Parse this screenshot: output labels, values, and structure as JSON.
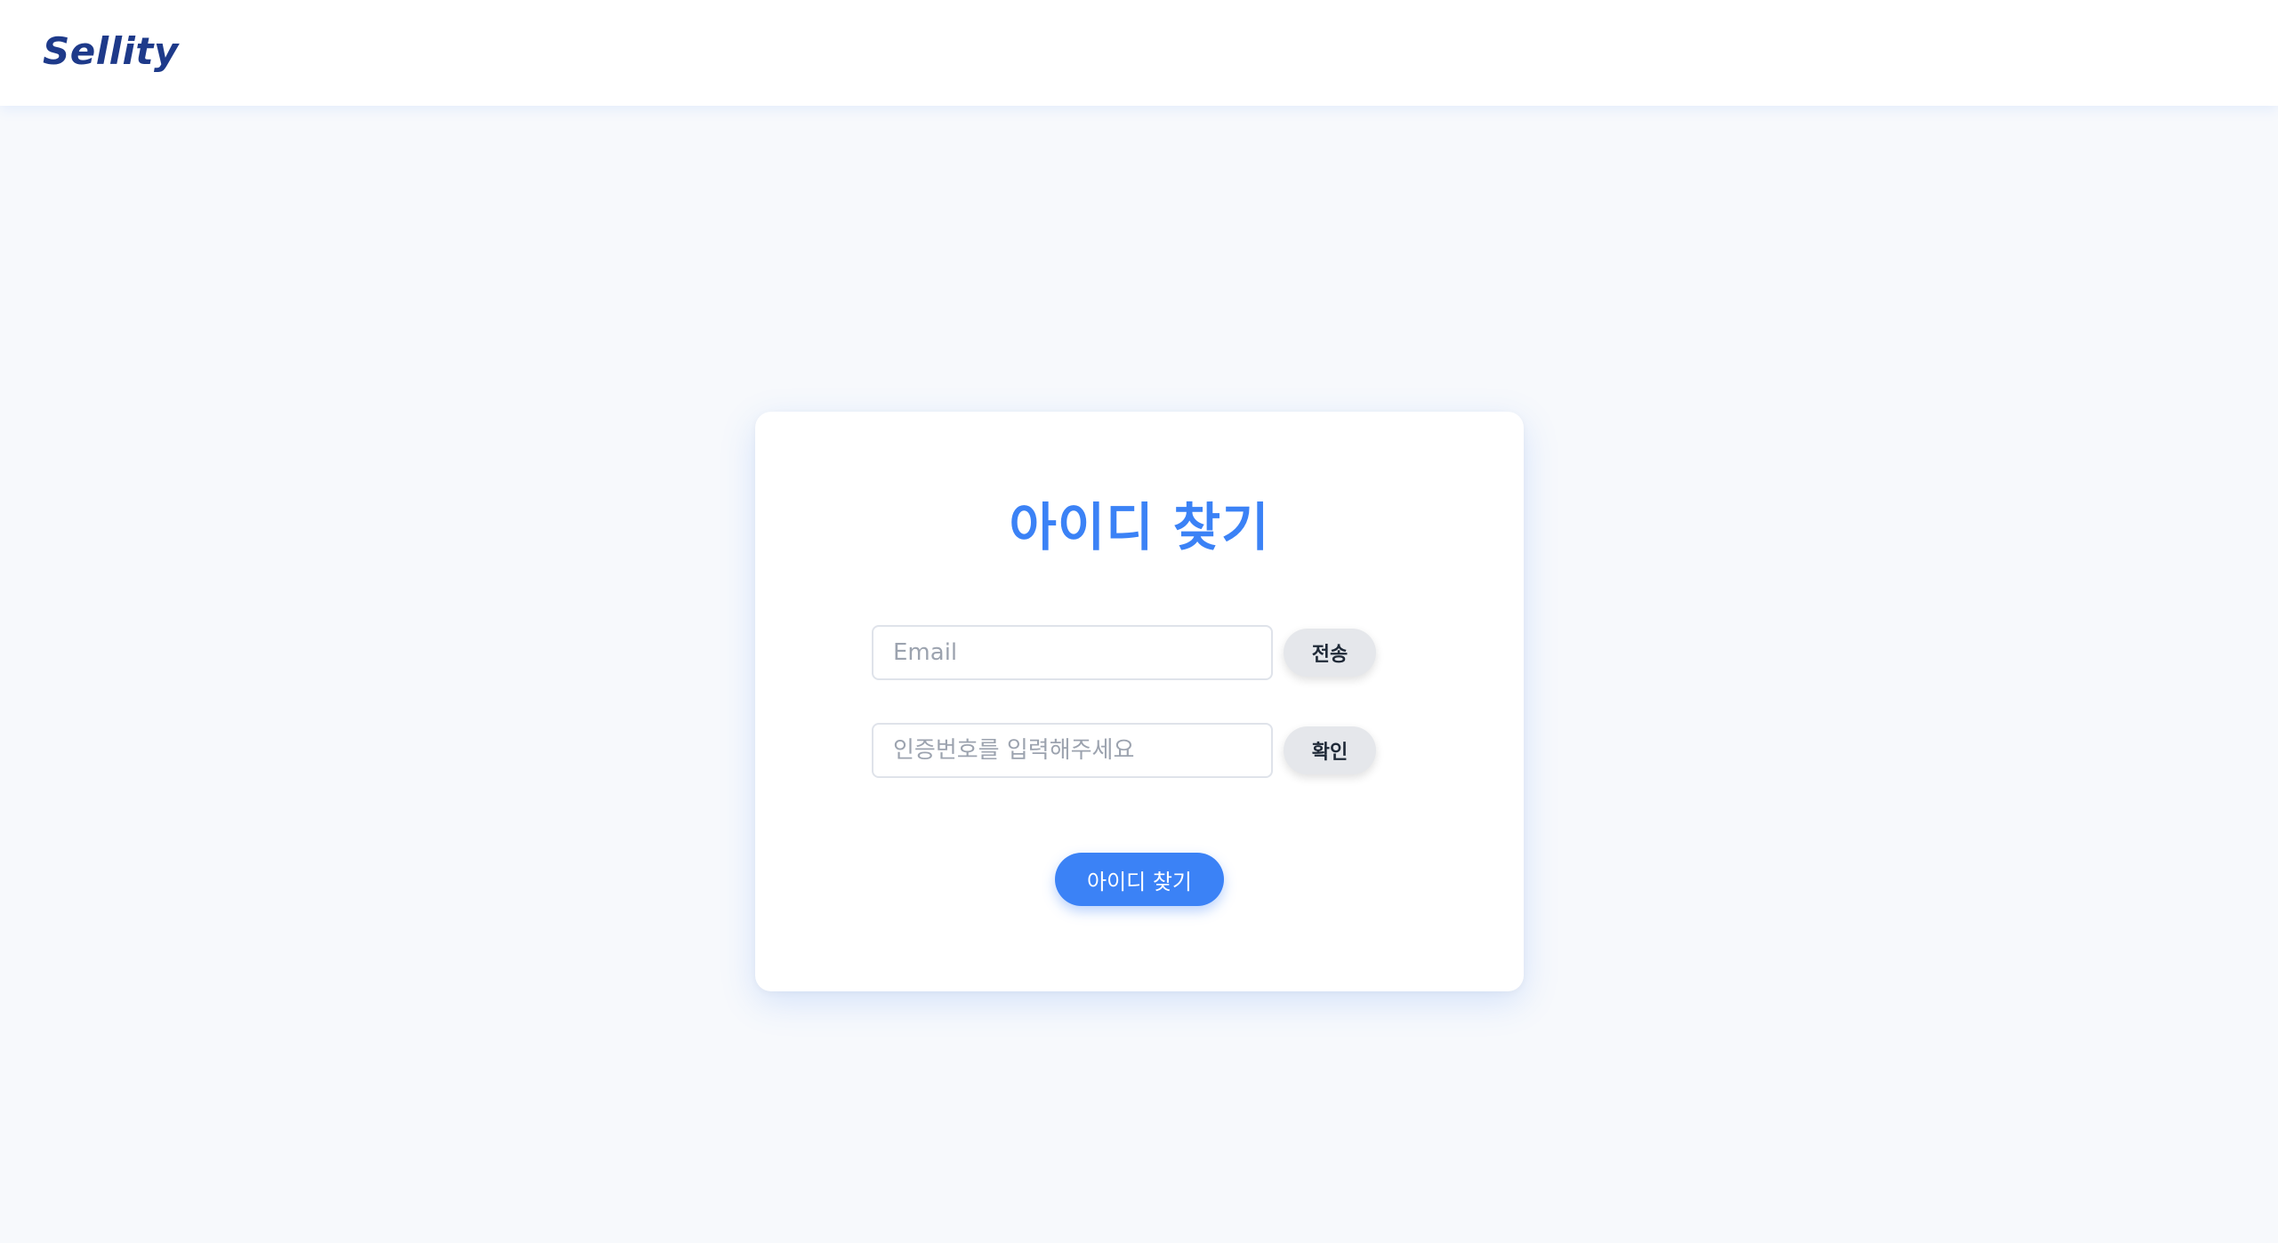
{
  "header": {
    "logo_text": "Sellity"
  },
  "card": {
    "title": "아이디 찾기",
    "email_field": {
      "value": "",
      "placeholder": "Email"
    },
    "send_button_label": "전송",
    "code_field": {
      "value": "",
      "placeholder": "인증번호를 입력해주세요"
    },
    "confirm_button_label": "확인",
    "submit_button_label": "아이디 찾기"
  },
  "colors": {
    "accent": "#3b82f6",
    "logo": "#1e3a8a",
    "page_background": "#f7f9fc",
    "secondary_button": "#e5e7eb"
  }
}
